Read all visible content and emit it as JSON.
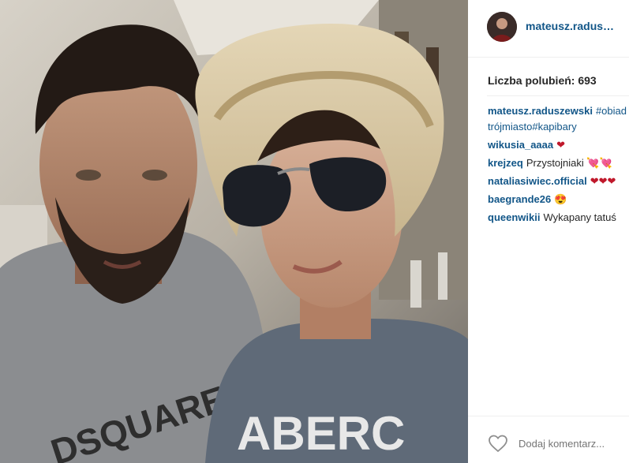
{
  "post": {
    "author": "mateusz.radus…",
    "likes_text": "Liczba polubień: 693",
    "photo_shirt_text_left": "DSQUARE",
    "photo_shirt_text_right": "ABERC"
  },
  "comments": [
    {
      "author": "mateusz.raduszewski",
      "text": "#obiad",
      "text_line2": "trójmiasto#kapibary"
    },
    {
      "author": "wikusia_aaaa",
      "text": "❤"
    },
    {
      "author": "krejzeq",
      "text": "Przystojniaki 💘💘"
    },
    {
      "author": "nataliasiwiec.official",
      "text": "❤❤❤"
    },
    {
      "author": "baegrande26",
      "text": "😍"
    },
    {
      "author": "queenwikii",
      "text": "Wykapany tatuś"
    }
  ],
  "footer": {
    "comment_placeholder": "Dodaj komentarz..."
  },
  "colors": {
    "link": "#125688",
    "like_heart": "#c0182b"
  }
}
